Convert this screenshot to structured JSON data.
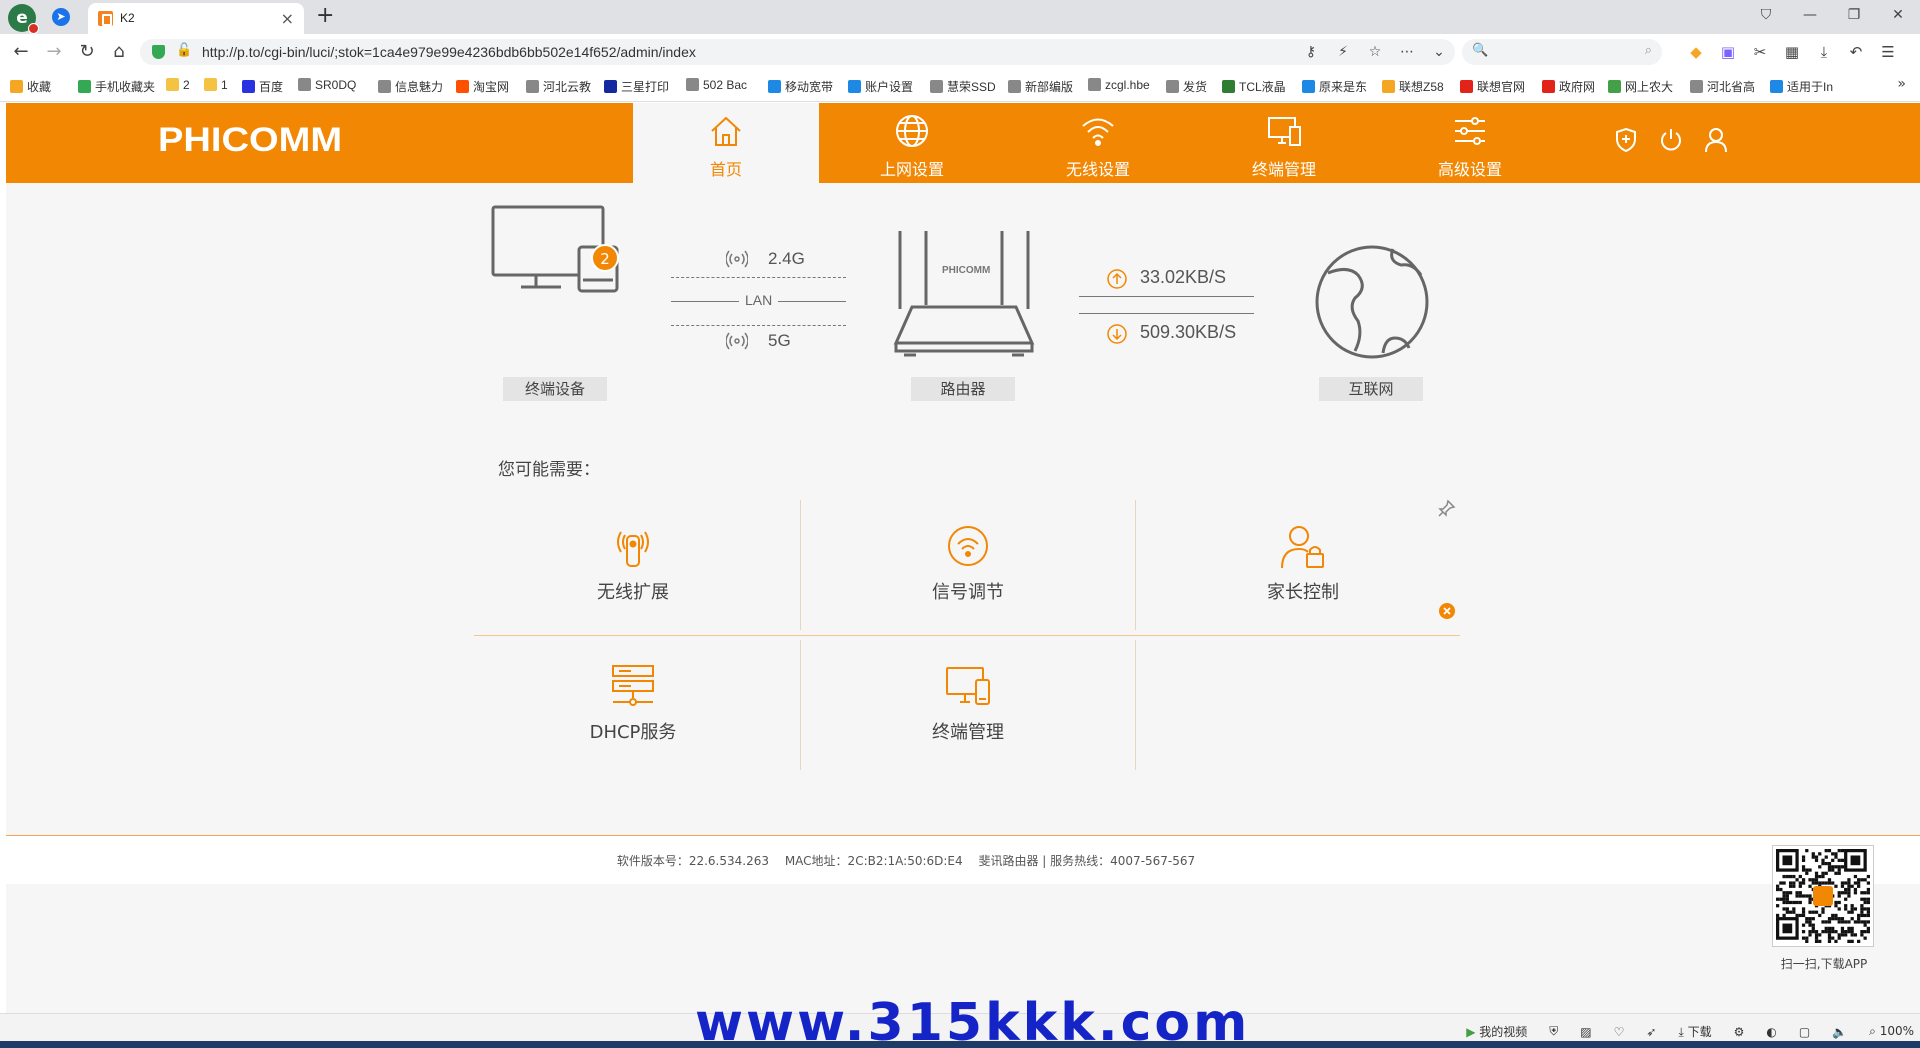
{
  "browser": {
    "tab_title": "K2",
    "url": "http://p.to/cgi-bin/luci/;stok=1ca4e979e99e4236bdb6bb502e14f652/admin/index",
    "search_placeholder": "",
    "bookmarks": [
      {
        "label": "收藏",
        "color": "#f5a623"
      },
      {
        "label": "手机收藏夹",
        "color": "#34a853"
      },
      {
        "label": "2",
        "color": "#f5c343"
      },
      {
        "label": "1",
        "color": "#f5c343"
      },
      {
        "label": "百度",
        "color": "#2932e1"
      },
      {
        "label": "SR0DQ",
        "color": "#888888"
      },
      {
        "label": "信息魅力",
        "color": "#888888"
      },
      {
        "label": "淘宝网",
        "color": "#ff5000"
      },
      {
        "label": "河北云教",
        "color": "#888888"
      },
      {
        "label": "三星打印",
        "color": "#1428a0"
      },
      {
        "label": "502 Bac",
        "color": "#888888"
      },
      {
        "label": "移动宽带",
        "color": "#1e88e5"
      },
      {
        "label": "账户设置",
        "color": "#1e88e5"
      },
      {
        "label": "慧荣SSD",
        "color": "#888888"
      },
      {
        "label": "新部编版",
        "color": "#888888"
      },
      {
        "label": "zcgl.hbe",
        "color": "#888888"
      },
      {
        "label": "发货",
        "color": "#888888"
      },
      {
        "label": "TCL液晶",
        "color": "#2e7d32"
      },
      {
        "label": "原来是东",
        "color": "#1e88e5"
      },
      {
        "label": "联想Z58",
        "color": "#f5a623"
      },
      {
        "label": "联想官网",
        "color": "#e2231a"
      },
      {
        "label": "政府网",
        "color": "#e2231a"
      },
      {
        "label": "网上农大",
        "color": "#43a047"
      },
      {
        "label": "河北省高",
        "color": "#888888"
      },
      {
        "label": "适用于In",
        "color": "#1e88e5"
      }
    ]
  },
  "router": {
    "brand": "PHICOMM",
    "nav": [
      {
        "label": "首页",
        "icon": "home-icon"
      },
      {
        "label": "上网设置",
        "icon": "globe-icon"
      },
      {
        "label": "无线设置",
        "icon": "wifi-icon"
      },
      {
        "label": "终端管理",
        "icon": "devices-icon"
      },
      {
        "label": "高级设置",
        "icon": "sliders-icon"
      }
    ],
    "diagram": {
      "terminal_label": "终端设备",
      "terminal_count": "2",
      "band_24": "2.4G",
      "lan": "LAN",
      "band_5": "5G",
      "router_label": "路由器",
      "router_brand": "PHICOMM",
      "upload_speed": "33.02KB/S",
      "download_speed": "509.30KB/S",
      "internet_label": "互联网"
    },
    "quick_title": "您可能需要：",
    "quick_items": [
      {
        "label": "无线扩展",
        "icon": "wireless-extend-icon"
      },
      {
        "label": "信号调节",
        "icon": "signal-adjust-icon"
      },
      {
        "label": "家长控制",
        "icon": "parental-control-icon"
      },
      {
        "label": "DHCP服务",
        "icon": "dhcp-server-icon"
      },
      {
        "label": "终端管理",
        "icon": "terminal-manage-icon"
      }
    ],
    "footer": {
      "version": "软件版本号：22.6.534.263",
      "mac": "MAC地址：2C:B2:1A:50:6D:E4",
      "hotline": "斐讯路由器 | 服务热线：4007-567-567"
    },
    "qr_caption": "扫一扫,下载APP"
  },
  "status_bar": {
    "watermark": "www.315kkk.com",
    "items": [
      "我的视频",
      "下载",
      "100%"
    ]
  },
  "colors": {
    "accent": "#f28703",
    "page_bg": "#f6f6f6"
  }
}
